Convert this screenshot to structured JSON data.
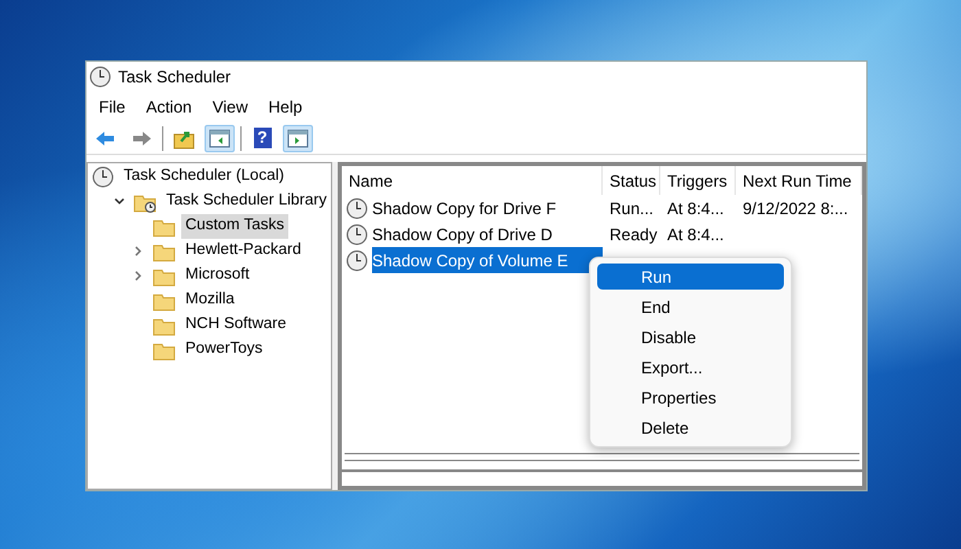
{
  "window": {
    "title": "Task Scheduler"
  },
  "menu_bar": [
    "File",
    "Action",
    "View",
    "Help"
  ],
  "toolbar": [
    {
      "kind": "back",
      "pressed": false
    },
    {
      "kind": "forward",
      "pressed": false
    },
    {
      "kind": "up",
      "pressed": false
    },
    {
      "kind": "tree",
      "pressed": true
    },
    {
      "kind": "help",
      "label": "?",
      "pressed": false
    },
    {
      "kind": "pane",
      "pressed": true
    }
  ],
  "tree": [
    {
      "label": "Task Scheduler (Local)",
      "kind": "root",
      "selected": false,
      "children": [
        {
          "label": "Task Scheduler Library",
          "kind": "library",
          "expanded": true,
          "selected": false,
          "children": [
            {
              "label": "Custom Tasks",
              "kind": "folder",
              "selected": true
            },
            {
              "label": "Hewlett-Packard",
              "kind": "folder",
              "expanded": false,
              "selected": false
            },
            {
              "label": "Microsoft",
              "kind": "folder",
              "expanded": false,
              "selected": false
            },
            {
              "label": "Mozilla",
              "kind": "folder",
              "selected": false
            },
            {
              "label": "NCH Software",
              "kind": "folder",
              "selected": false
            },
            {
              "label": "PowerToys",
              "kind": "folder",
              "selected": false
            }
          ]
        }
      ]
    }
  ],
  "table": {
    "columns": [
      "Name",
      "Status",
      "Triggers",
      "Next Run Time"
    ],
    "rows": [
      {
        "name": "Shadow Copy for Drive F",
        "status": "Run...",
        "triggers": "At 8:4...",
        "next_run_time": "9/12/2022 8:...",
        "selected": false
      },
      {
        "name": "Shadow Copy of Drive D",
        "status": "Ready",
        "triggers": "At 8:4...",
        "next_run_time": "",
        "selected": false
      },
      {
        "name": "Shadow Copy of Volume E",
        "status": "",
        "triggers": "",
        "next_run_time": "",
        "selected": true
      }
    ]
  },
  "context_menu": [
    {
      "label": "Run",
      "selected": true
    },
    {
      "label": "End",
      "selected": false
    },
    {
      "label": "Disable",
      "selected": false
    },
    {
      "label": "Export...",
      "selected": false
    },
    {
      "label": "Properties",
      "selected": false
    },
    {
      "label": "Delete",
      "selected": false
    }
  ]
}
